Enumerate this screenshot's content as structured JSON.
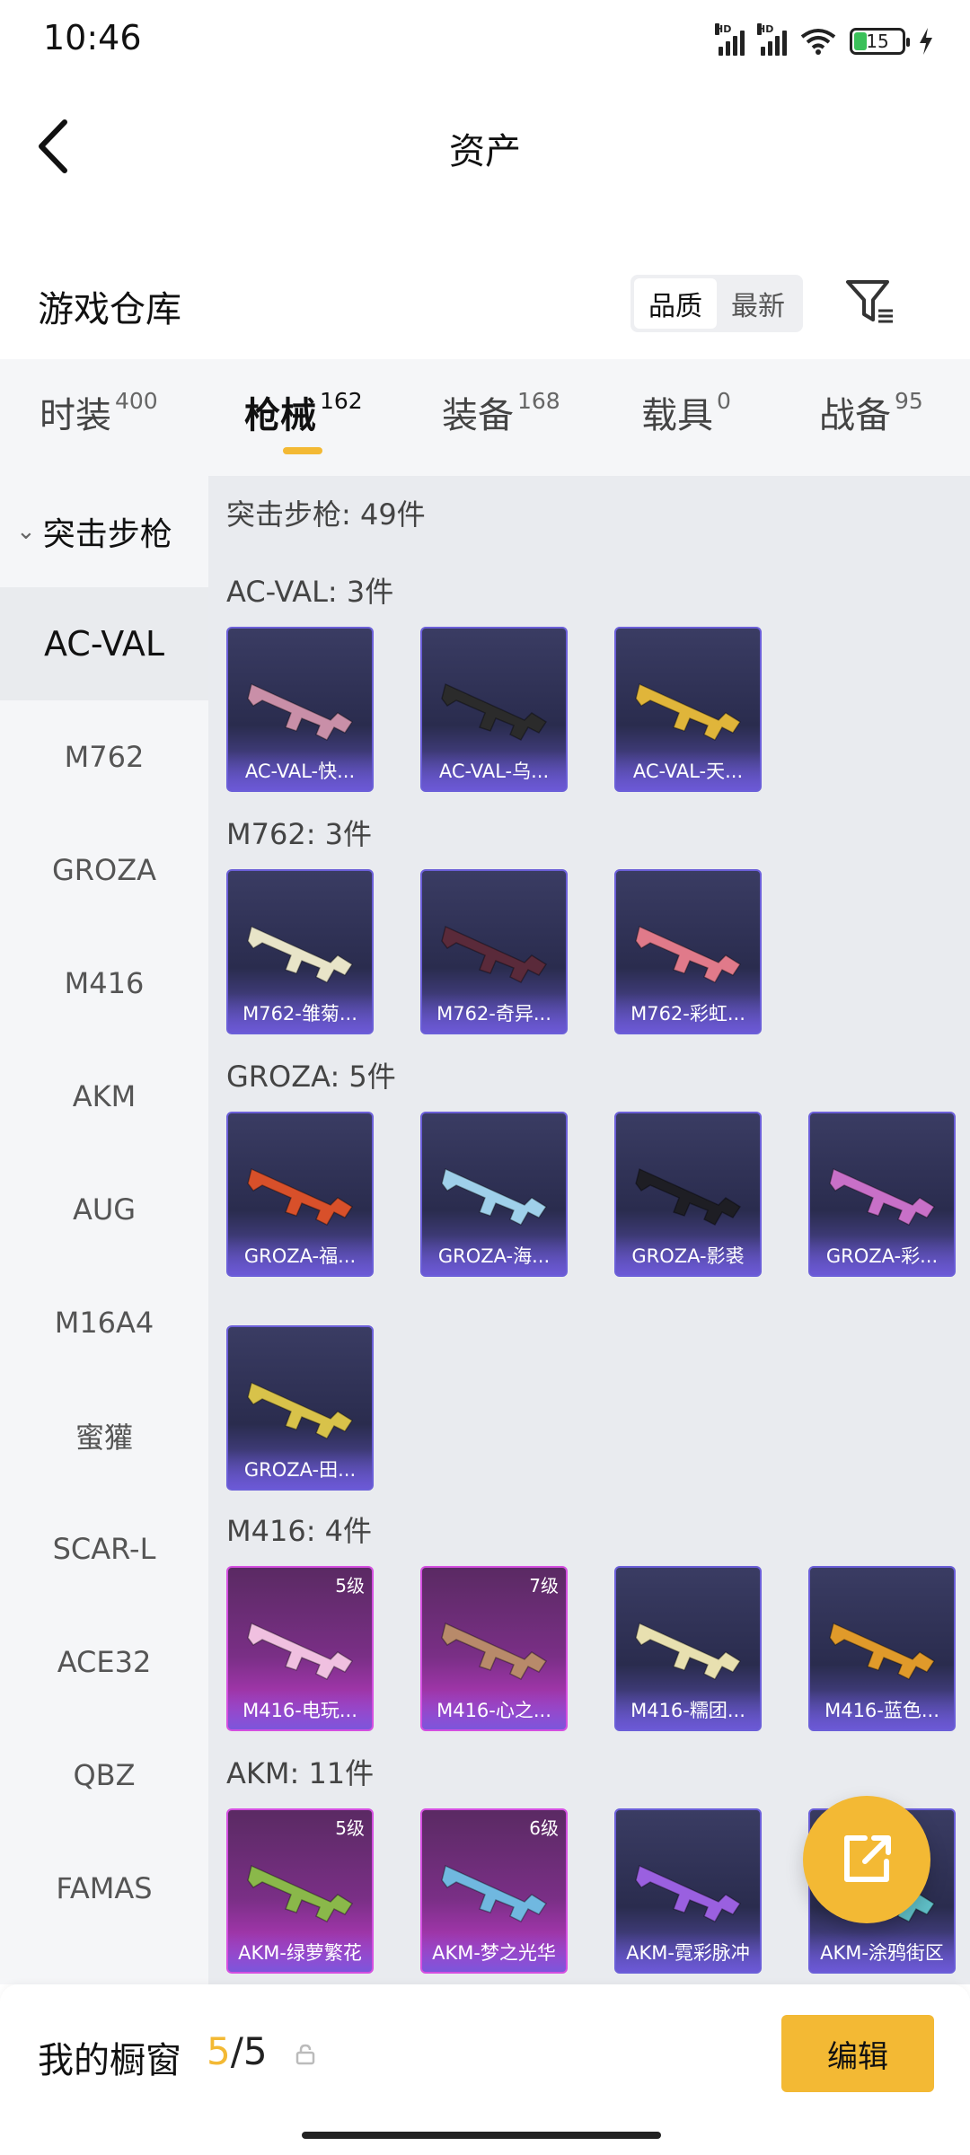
{
  "status": {
    "time": "10:46",
    "battery": "15",
    "hd": "HD"
  },
  "header": {
    "title": "资产"
  },
  "warehouse": {
    "title": "游戏仓库",
    "sort_quality": "品质",
    "sort_newest": "最新"
  },
  "tabs": [
    {
      "label": "时装",
      "count": "400"
    },
    {
      "label": "枪械",
      "count": "162"
    },
    {
      "label": "装备",
      "count": "168"
    },
    {
      "label": "载具",
      "count": "0"
    },
    {
      "label": "战备",
      "count": "95"
    }
  ],
  "sidebar": {
    "category": "突击步枪",
    "items": [
      "AC-VAL",
      "M762",
      "GROZA",
      "M416",
      "AKM",
      "AUG",
      "M16A4",
      "蜜獾",
      "SCAR-L",
      "ACE32",
      "QBZ",
      "FAMAS"
    ]
  },
  "content": {
    "summary": "突击步枪: 49件",
    "groups": [
      {
        "title": "AC-VAL: 3件",
        "items": [
          {
            "label": "AC-VAL-快...",
            "level": "",
            "rarity": "purple",
            "color": "#c98fa8"
          },
          {
            "label": "AC-VAL-乌...",
            "level": "",
            "rarity": "purple",
            "color": "#2b2b2b"
          },
          {
            "label": "AC-VAL-天...",
            "level": "",
            "rarity": "purple",
            "color": "#e0b53a"
          }
        ]
      },
      {
        "title": "M762: 3件",
        "items": [
          {
            "label": "M762-雏菊...",
            "level": "",
            "rarity": "purple",
            "color": "#e8e4c8"
          },
          {
            "label": "M762-奇异...",
            "level": "",
            "rarity": "purple",
            "color": "#5a2a3a"
          },
          {
            "label": "M762-彩虹...",
            "level": "",
            "rarity": "purple",
            "color": "#e07a8a"
          }
        ]
      },
      {
        "title": "GROZA: 5件",
        "items": [
          {
            "label": "GROZA-福...",
            "level": "",
            "rarity": "purple",
            "color": "#d8502a"
          },
          {
            "label": "GROZA-海...",
            "level": "",
            "rarity": "purple",
            "color": "#9fd0ea"
          },
          {
            "label": "GROZA-影裘",
            "level": "",
            "rarity": "purple",
            "color": "#1e1e24"
          },
          {
            "label": "GROZA-彩...",
            "level": "",
            "rarity": "purple",
            "color": "#c870c8"
          },
          {
            "label": "GROZA-田...",
            "level": "",
            "rarity": "purple",
            "color": "#d8c24a"
          }
        ]
      },
      {
        "title": "M416: 4件",
        "items": [
          {
            "label": "M416-电玩...",
            "level": "5级",
            "rarity": "pink",
            "color": "#f0c0e0"
          },
          {
            "label": "M416-心之...",
            "level": "7级",
            "rarity": "pink",
            "color": "#b88a6a"
          },
          {
            "label": "M416-糯团...",
            "level": "",
            "rarity": "purple",
            "color": "#e8e0b0"
          },
          {
            "label": "M416-蓝色...",
            "level": "",
            "rarity": "purple",
            "color": "#e09a2a"
          }
        ]
      },
      {
        "title": "AKM: 11件",
        "items": [
          {
            "label": "AKM-绿萝繁花",
            "level": "5级",
            "rarity": "pink",
            "color": "#8ab84a"
          },
          {
            "label": "AKM-梦之光华",
            "level": "6级",
            "rarity": "pink",
            "color": "#70b8e0"
          },
          {
            "label": "AKM-霓彩脉冲",
            "level": "",
            "rarity": "purple",
            "color": "#9a60e0"
          },
          {
            "label": "AKM-涂鸦街区",
            "level": "",
            "rarity": "purple",
            "color": "#60c0c8"
          }
        ]
      }
    ]
  },
  "showcase": {
    "label": "我的橱窗",
    "current": "5",
    "separator": "/",
    "max": "5",
    "edit": "编辑"
  },
  "icons": [
    "back-arrow-icon",
    "filter-icon",
    "share-icon",
    "lock-icon",
    "chevron-down-icon",
    "wifi-icon",
    "signal-icon",
    "battery-icon",
    "charging-icon"
  ],
  "colors": {
    "accent": "#f3b934",
    "rarity_purple": "#6b5fd8",
    "rarity_pink": "#d44fe0"
  }
}
